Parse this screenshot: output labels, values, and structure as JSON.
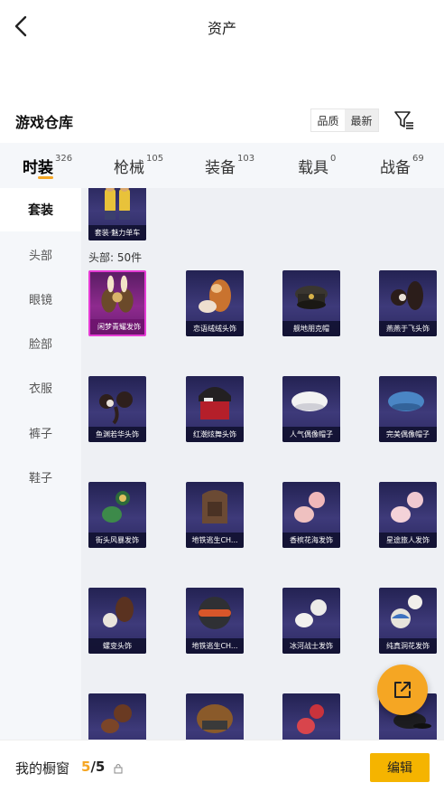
{
  "header": {
    "title": "资产"
  },
  "warehouse": {
    "title": "游戏仓库",
    "sort_options": [
      "品质",
      "最新"
    ]
  },
  "tabs": [
    {
      "label": "时装",
      "count": "326"
    },
    {
      "label": "枪械",
      "count": "105"
    },
    {
      "label": "装备",
      "count": "103"
    },
    {
      "label": "载具",
      "count": "0"
    },
    {
      "label": "战备",
      "count": "69"
    }
  ],
  "sidebar": {
    "items": [
      "套装",
      "头部",
      "眼镜",
      "脸部",
      "衣服",
      "裤子",
      "鞋子"
    ]
  },
  "content": {
    "suit_card": {
      "name": "套装·魅力单车",
      "icon": "cyclist-outfit-icon"
    },
    "section_label": "头部: 50件",
    "cards": [
      {
        "name": "闲梦青耀发饰",
        "icon": "bunny-ear-hair-icon",
        "rarity": "legendary"
      },
      {
        "name": "恋语绒绒头饰",
        "icon": "fluffy-headwear-icon",
        "rarity": "epic"
      },
      {
        "name": "舰地朋克帽",
        "icon": "captain-cap-icon",
        "rarity": "epic"
      },
      {
        "name": "燕燕于飞头饰",
        "icon": "twin-bun-hair-icon",
        "rarity": "epic"
      },
      {
        "name": "鱼渊若华头饰",
        "icon": "braid-hair-icon",
        "rarity": "epic"
      },
      {
        "name": "红潮炫舞头饰",
        "icon": "red-hair-beanie-icon",
        "rarity": "epic"
      },
      {
        "name": "人气偶像帽子",
        "icon": "white-beret-icon",
        "rarity": "epic"
      },
      {
        "name": "完美偶像帽子",
        "icon": "blue-beret-icon",
        "rarity": "epic"
      },
      {
        "name": "街头风暴发饰",
        "icon": "street-hair-icon",
        "rarity": "epic"
      },
      {
        "name": "地铁逃生CH...",
        "icon": "hood-helmet-icon",
        "rarity": "epic"
      },
      {
        "name": "香槟花海发饰",
        "icon": "pink-hair-icon",
        "rarity": "epic"
      },
      {
        "name": "星途旅人发饰",
        "icon": "star-hair-icon",
        "rarity": "epic"
      },
      {
        "name": "螺变头饰",
        "icon": "swirl-hair-icon",
        "rarity": "epic"
      },
      {
        "name": "地铁逃生CH...",
        "icon": "goggle-helmet-icon",
        "rarity": "epic"
      },
      {
        "name": "冰河战士发饰",
        "icon": "white-hair-icon",
        "rarity": "epic"
      },
      {
        "name": "纯真洞花发饰",
        "icon": "bear-helmet-icon",
        "rarity": "epic"
      },
      {
        "name": "",
        "icon": "brown-hair-icon",
        "rarity": "epic"
      },
      {
        "name": "",
        "icon": "fur-hat-icon",
        "rarity": "epic"
      },
      {
        "name": "",
        "icon": "red-mask-icon",
        "rarity": "epic"
      },
      {
        "name": "",
        "icon": "black-cap-icon",
        "rarity": "epic"
      }
    ]
  },
  "bottom": {
    "showcase_label": "我的橱窗",
    "used": "5",
    "separator": "/",
    "total": "5",
    "edit_label": "编辑"
  },
  "colors": {
    "accent": "#f5a623",
    "legendary": "#e53bd4",
    "epic_bg": "#2f2d66"
  }
}
